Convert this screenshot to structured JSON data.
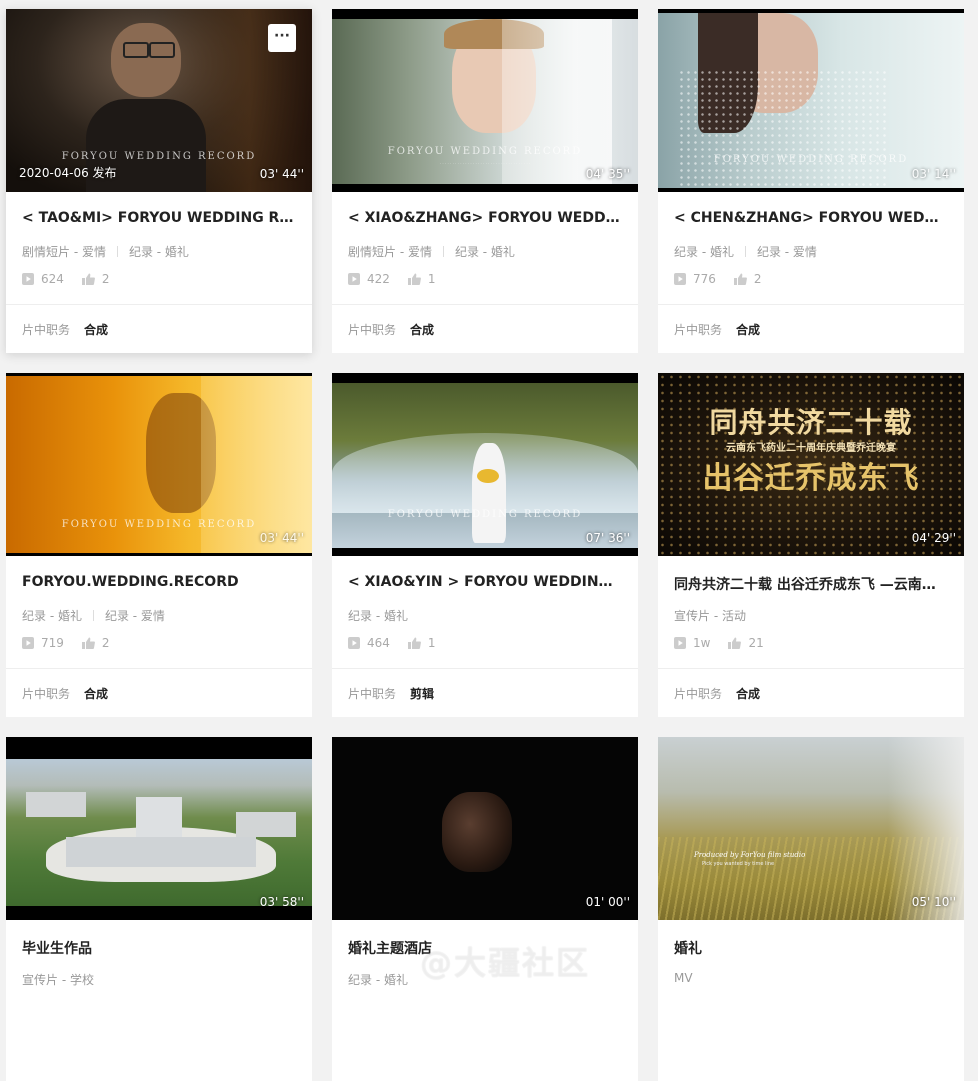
{
  "cards": [
    {
      "title": "< TAO&MI> FORYOU WEDDING RECORD",
      "tags": [
        "剧情短片 - 爱情",
        "纪录 - 婚礼"
      ],
      "views": "624",
      "likes": "2",
      "role_label": "片中职务",
      "role": "合成",
      "duration": "03' 44''",
      "pubdate": "2020-04-06 发布",
      "more": "···",
      "watermark": "FORYOU WEDDING RECORD"
    },
    {
      "title": "< XIAO&ZHANG> FORYOU WEDDING RECORD",
      "tags": [
        "剧情短片 - 爱情",
        "纪录 - 婚礼"
      ],
      "views": "422",
      "likes": "1",
      "role_label": "片中职务",
      "role": "合成",
      "duration": "04' 35''",
      "watermark": "FORYOU WEDDING RECORD"
    },
    {
      "title": "< CHEN&ZHANG> FORYOU WEDDING RECORD",
      "tags": [
        "纪录 - 婚礼",
        "纪录 - 爱情"
      ],
      "views": "776",
      "likes": "2",
      "role_label": "片中职务",
      "role": "合成",
      "duration": "03' 14''",
      "watermark": "FORYOU WEDDING RECORD"
    },
    {
      "title": "FORYOU.WEDDING.RECORD",
      "tags": [
        "纪录 - 婚礼",
        "纪录 - 爱情"
      ],
      "views": "719",
      "likes": "2",
      "role_label": "片中职务",
      "role": "合成",
      "duration": "03' 44''",
      "watermark": "FORYOU WEDDING RECORD"
    },
    {
      "title": "< XIAO&YIN > FORYOU WEDDING RECORD",
      "tags": [
        "纪录 - 婚礼"
      ],
      "views": "464",
      "likes": "1",
      "role_label": "片中职务",
      "role": "剪辑",
      "duration": "07' 36''",
      "watermark": "FORYOU WEDDING RECORD"
    },
    {
      "title": "同舟共济二十载 出谷迁乔成东飞 —云南东飞药业二十周年庆典",
      "tags": [
        "宣传片 - 活动"
      ],
      "views": "1w",
      "likes": "21",
      "role_label": "片中职务",
      "role": "合成",
      "duration": "04' 29''",
      "thumb_title1": "同舟共济二十载",
      "thumb_sub": "云南东飞药业二十周年庆典暨乔迁晚宴",
      "thumb_title2": "出谷迁乔成东飞"
    },
    {
      "title": "毕业生作品",
      "tags": [
        "宣传片 - 学校"
      ],
      "duration": "03' 58''"
    },
    {
      "title": "婚礼主题酒店",
      "tags": [
        "纪录 - 婚礼"
      ],
      "duration": "01' 00''"
    },
    {
      "title": "婚礼",
      "tags": [
        "MV"
      ],
      "duration": "05' 10''",
      "thumb_text1": "Produced by ForYou film studio",
      "thumb_text2": "Pick you wanted by time line"
    }
  ],
  "site_watermark": "@大疆社区",
  "icons": {
    "views": "play-icon",
    "likes": "thumbs-up-icon",
    "more": "more-dots-icon"
  }
}
